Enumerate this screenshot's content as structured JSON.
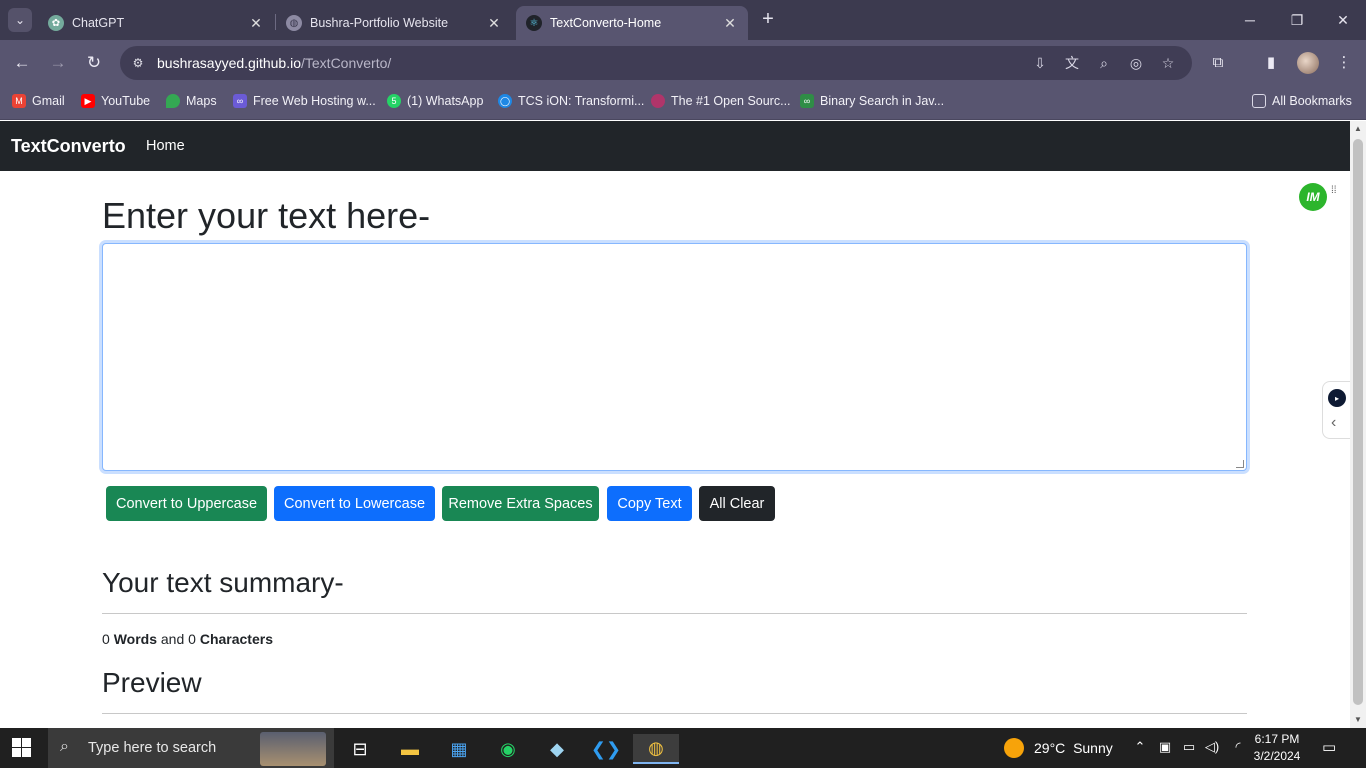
{
  "browser": {
    "tabs": [
      {
        "title": "ChatGPT",
        "active": false
      },
      {
        "title": "Bushra-Portfolio Website",
        "active": false
      },
      {
        "title": "TextConverto-Home",
        "active": true
      }
    ],
    "url_domain": "bushrasayyed.github.io",
    "url_path": "/TextConverto/",
    "bookmarks": [
      {
        "label": "Gmail",
        "color": "#ea4335"
      },
      {
        "label": "YouTube",
        "color": "#ff0000"
      },
      {
        "label": "Maps",
        "color": "#34a853"
      },
      {
        "label": "Free Web Hosting w...",
        "color": "#6b5bd6"
      },
      {
        "label": "(1) WhatsApp",
        "color": "#25d366"
      },
      {
        "label": "TCS iON: Transformi...",
        "color": "#1e88e5"
      },
      {
        "label": "The #1 Open Sourc...",
        "color": "#b0356a"
      },
      {
        "label": "Binary Search in Jav...",
        "color": "#2f8d46"
      },
      {
        "label": "All Bookmarks",
        "color": "#dad8e6"
      }
    ]
  },
  "page": {
    "navbar": {
      "brand": "TextConverto",
      "links": [
        "Home"
      ]
    },
    "heading": "Enter your text here-",
    "textarea_value": "",
    "buttons": [
      {
        "label": "Convert to Uppercase",
        "color": "#198754"
      },
      {
        "label": "Convert to Lowercase",
        "color": "#0d6efd"
      },
      {
        "label": "Remove Extra Spaces",
        "color": "#198754"
      },
      {
        "label": "Copy Text",
        "color": "#0d6efd"
      },
      {
        "label": "All Clear",
        "color": "#212529"
      }
    ],
    "summary_heading": "Your text summary-",
    "summary": {
      "words": "0",
      "words_label": "Words",
      "and": "and",
      "chars": "0",
      "chars_label": "Characters"
    },
    "preview_heading": "Preview"
  },
  "taskbar": {
    "search_placeholder": "Type here to search",
    "weather": {
      "temp": "29°C",
      "condition": "Sunny"
    },
    "time": "6:17 PM",
    "date": "3/2/2024"
  }
}
